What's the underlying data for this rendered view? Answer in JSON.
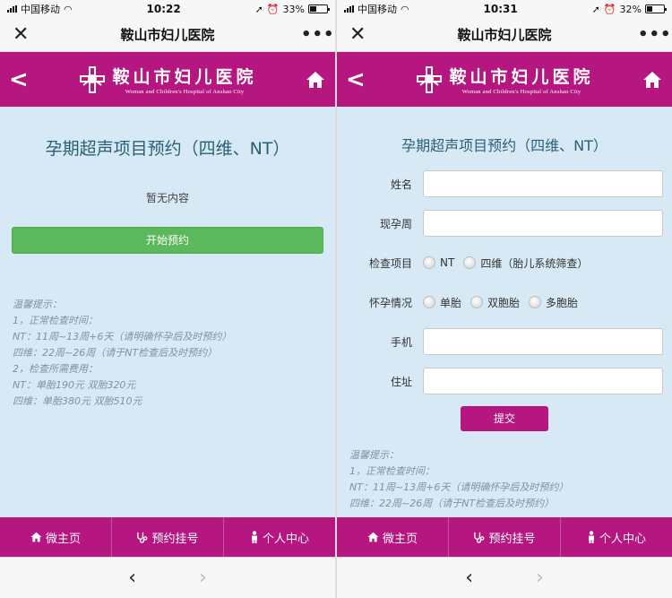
{
  "colors": {
    "brand": "#b5167f",
    "content_bg": "#d7e9f5",
    "start_button": "#5cb85c",
    "title_text": "#2b5f76",
    "tips_text": "#7b93a6"
  },
  "icons": {
    "close": "close-icon",
    "more": "more-icon",
    "back": "back-icon",
    "home": "home-icon",
    "tab_home": "home-icon",
    "tab_appointment": "stethoscope-icon",
    "tab_user": "person-icon",
    "nav_back": "chevron-left-icon",
    "nav_forward": "chevron-right-icon"
  },
  "left": {
    "status": {
      "carrier": "中国移动",
      "time": "10:22",
      "battery": "33%",
      "battery_level": 0.33
    },
    "navbar_title": "鞍山市妇儿医院",
    "logo": {
      "cn": "鞍山市妇儿医院",
      "en": "Woman and Children's Hospital of Anshan City"
    },
    "page_title": "孕期超声项目预约（四维、NT）",
    "empty_text": "暂无内容",
    "start_button": "开始预约",
    "tips": [
      "温馨提示：",
      "1，正常检查时间：",
      "NT：11周~13周+6天（请明确怀孕后及时预约）",
      "四维：22周~26周（请于NT检查后及时预约）",
      "2，检查所需费用：",
      "NT：单胎190元 双胎320元",
      "四维：单胎380元 双胎510元"
    ],
    "tabs": [
      "微主页",
      "预约挂号",
      "个人中心"
    ]
  },
  "right": {
    "status": {
      "carrier": "中国移动",
      "time": "10:31",
      "battery": "32%",
      "battery_level": 0.32
    },
    "navbar_title": "鞍山市妇儿医院",
    "logo": {
      "cn": "鞍山市妇儿医院",
      "en": "Woman and Children's Hospital of Anshan City"
    },
    "form_title": "孕期超声项目预约（四维、NT）",
    "fields": {
      "name": "姓名",
      "weeks": "现孕周",
      "exam": "检查项目",
      "pregnancy": "怀孕情况",
      "phone": "手机",
      "address": "住址"
    },
    "exam_options": [
      "NT",
      "四维（胎儿系统筛查）"
    ],
    "pregnancy_options": [
      "单胎",
      "双胞胎",
      "多胞胎"
    ],
    "submit": "提交",
    "tips": [
      "温馨提示：",
      "1，正常检查时间：",
      "NT：11周~13周+6天（请明确怀孕后及时预约）",
      "四维：22周~26周（请于NT检查后及时预约）"
    ],
    "tabs": [
      "微主页",
      "预约挂号",
      "个人中心"
    ]
  }
}
